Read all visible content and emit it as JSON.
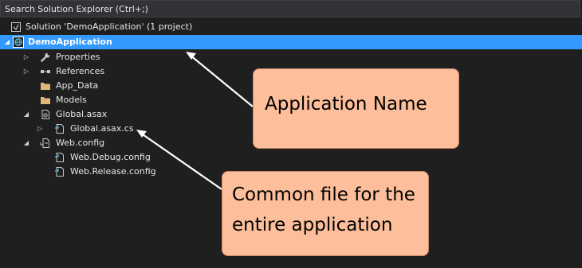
{
  "search": {
    "placeholder": "Search Solution Explorer (Ctrl+;)"
  },
  "tree": {
    "solution": "Solution 'DemoApplication' (1 project)",
    "project": "DemoApplication",
    "properties": "Properties",
    "references": "References",
    "app_data": "App_Data",
    "models": "Models",
    "global_asax": "Global.asax",
    "global_asax_cs": "Global.asax.cs",
    "web_config": "Web.config",
    "web_debug_config": "Web.Debug.config",
    "web_release_config": "Web.Release.config"
  },
  "annotations": {
    "app_name": "Application Name",
    "common_file_line1": "Common file for the",
    "common_file_line2": "entire application"
  },
  "colors": {
    "background": "#1f1f1f",
    "selection": "#3399ff",
    "callout": "#fdbf9b",
    "folder": "#dcb67a"
  }
}
